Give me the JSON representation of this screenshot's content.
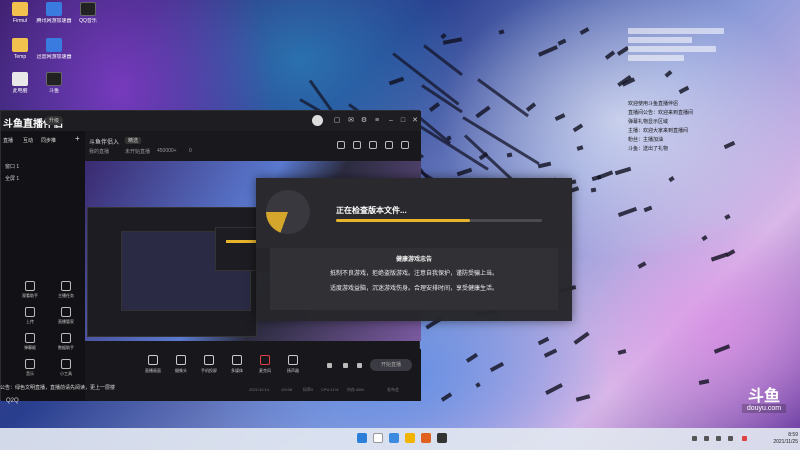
{
  "desktop_icons": [
    {
      "label": "Firmul",
      "kind": "folder"
    },
    {
      "label": "腾讯网游加速器",
      "kind": "app"
    },
    {
      "label": "QQ音乐",
      "kind": "app"
    },
    {
      "label": "Temp",
      "kind": "folder"
    },
    {
      "label": "迅雷网游加速器",
      "kind": "app"
    },
    {
      "label": "此电脑",
      "kind": "app"
    },
    {
      "label": "斗鱼",
      "kind": "app"
    }
  ],
  "app": {
    "brand": "斗鱼直播伴侣",
    "brand_badge": "升级",
    "sidebar_tabs": [
      "直播",
      "互动",
      "同步推"
    ],
    "sidebar_items": [
      "窗口 1",
      "全屏 1"
    ],
    "tools": [
      {
        "label": "观看助手"
      },
      {
        "label": "主播任务"
      },
      {
        "label": "上传"
      },
      {
        "label": "直播管家"
      },
      {
        "label": "弹幕姬"
      },
      {
        "label": "数据助手"
      },
      {
        "label": "音乐"
      },
      {
        "label": "小工具"
      }
    ],
    "room": {
      "name": "斗鱼伴侣入",
      "tag": "精选",
      "sub": [
        "我的直播",
        "未开始直播",
        "450000+",
        "0"
      ]
    },
    "bottom_bar": [
      {
        "label": "直播画面"
      },
      {
        "label": "摄像头"
      },
      {
        "label": "手机投屏"
      },
      {
        "label": "多媒体"
      },
      {
        "label": "麦克风"
      },
      {
        "label": "扬声器"
      }
    ],
    "start_label": "开始直播",
    "status": [
      "2021/10:14",
      "1/5:08",
      "码率0",
      "CPU:11%",
      "内存:48%",
      "发布会"
    ],
    "footer_note": "公告：绿色文明直播，直播前请先阅读，更上一层楼",
    "footer_brand": "Q2Q"
  },
  "modal": {
    "checking_text": "正在检查版本文件...",
    "progress": 0.65,
    "advice_title": "健康游戏忠告",
    "advice_lines": [
      "抵制不良游戏，拒绝盗版游戏。注意自我保护，谨防受骗上当。",
      "适度游戏益脑，沉迷游戏伤身。合理安排时间，享受健康生活。"
    ]
  },
  "side_chat": [
    "欢迎使用斗鱼直播伴侣",
    "直播间公告：欢迎来到直播间",
    "弹幕礼物显示区域",
    "主播：欢迎大家来到直播间",
    "粉丝：主播加油",
    "斗鱼：送出了礼物"
  ],
  "watermark": {
    "big": "斗鱼",
    "small": "douyu.com"
  },
  "clock": {
    "time": "8:59",
    "date": "2021/11/25"
  },
  "colors": {
    "accent": "#e7b42c",
    "app_bg": "#17171c",
    "modal_bg": "#26262a"
  }
}
